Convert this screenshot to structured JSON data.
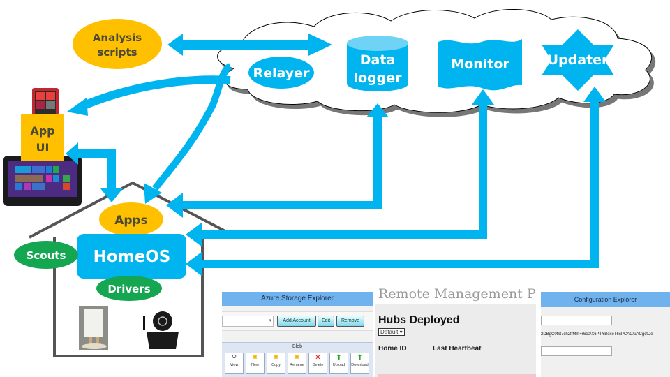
{
  "diagram": {
    "analysis_scripts": "Analysis scripts",
    "app_ui_line1": "App",
    "app_ui_line2": "UI",
    "cloud": {
      "relayer": "Relayer",
      "data_logger_line1": "Data",
      "data_logger_line2": "logger",
      "monitor": "Monitor",
      "updater": "Updater"
    },
    "home": {
      "apps": "Apps",
      "homeos": "HomeOS",
      "scouts": "Scouts",
      "drivers": "Drivers"
    },
    "colors": {
      "arrow_blue": "#00b4ef",
      "amber": "#ffc000",
      "green": "#14a650",
      "house_gray": "#555555",
      "dark_text": "#4a4a3a"
    }
  },
  "screenshots": {
    "azure_storage_explorer": {
      "title": "Azure Storage Explorer",
      "buttons": [
        "Add Account",
        "Edit",
        "Remove"
      ],
      "group_label": "Blob",
      "tools": [
        "View",
        "New",
        "Copy",
        "Rename",
        "Delete",
        "Upload",
        "Download"
      ]
    },
    "remote_management": {
      "title": "Remote Management Po",
      "heading": "Hubs Deployed",
      "select_value": "Default",
      "columns": [
        "Home ID",
        "Last Heartbeat"
      ]
    },
    "configuration_explorer": {
      "title": "Configuration Explorer",
      "field_value": "2DBgC0fkt7ch2f/Mm+r6c0/X6PTYBoxeT6cPCAC/uACgctDe"
    }
  }
}
